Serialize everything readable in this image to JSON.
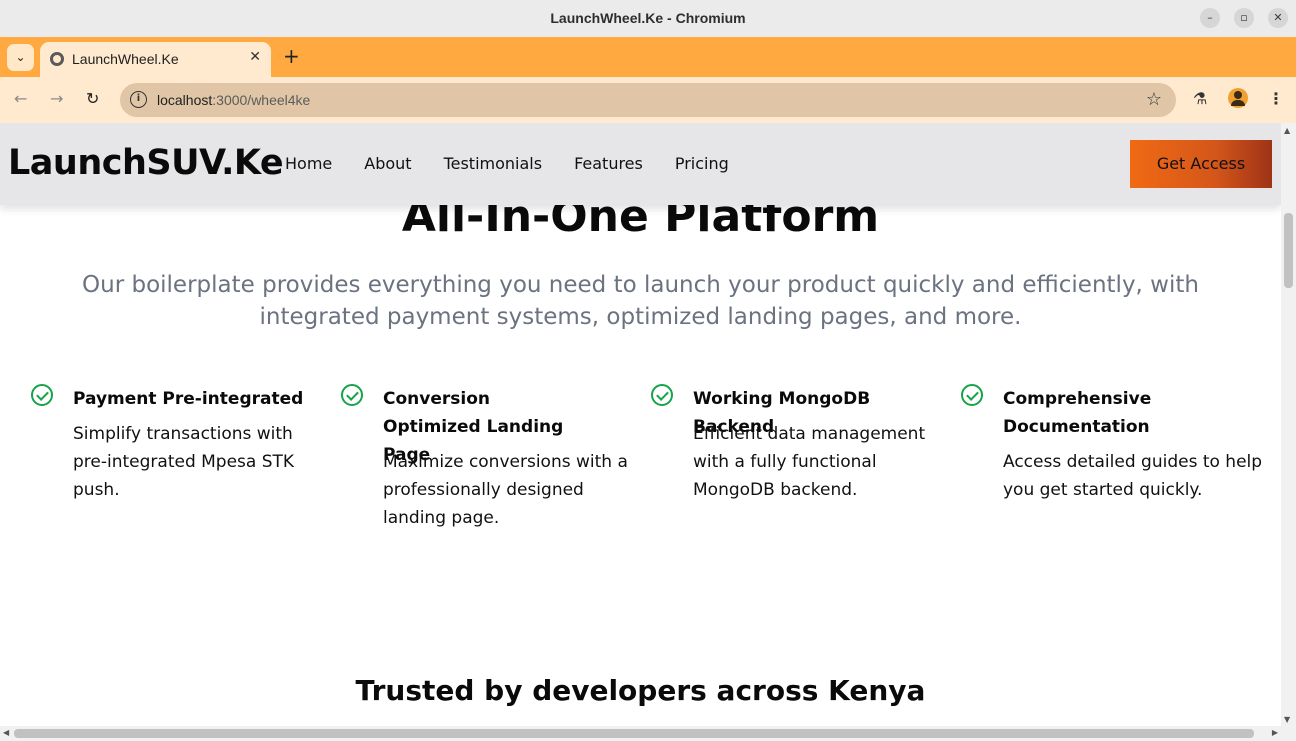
{
  "window": {
    "title": "LaunchWheel.Ke - Chromium"
  },
  "tab": {
    "title": "LaunchWheel.Ke"
  },
  "address": {
    "host": "localhost",
    "path": ":3000/wheel4ke"
  },
  "site": {
    "brand": "LaunchSUV.Ke",
    "nav": [
      "Home",
      "About",
      "Testimonials",
      "Features",
      "Pricing"
    ],
    "cta": "Get Access"
  },
  "hero": {
    "title": "All-In-One Platform",
    "subtitle": "Our boilerplate provides everything you need to launch your product quickly and efficiently, with integrated payment systems, optimized landing pages, and more."
  },
  "features": [
    {
      "title": "Payment Pre-integrated",
      "desc": "Simplify transactions with pre-integrated Mpesa STK push."
    },
    {
      "title": "Conversion Optimized Landing Page",
      "desc": "Maximize conversions with a professionally designed landing page."
    },
    {
      "title": "Working MongoDB Backend",
      "desc": "Efficient data management with a fully functional MongoDB backend."
    },
    {
      "title": "Comprehensive Documentation",
      "desc": "Access detailed guides to help you get started quickly."
    }
  ],
  "trusted": {
    "title": "Trusted by developers across Kenya"
  },
  "icons": {
    "tab_list": "chevron-down-icon",
    "favicon": "globe-icon",
    "close": "close-icon",
    "new_tab": "plus-icon",
    "back": "arrow-left-icon",
    "forward": "arrow-right-icon",
    "reload": "reload-icon",
    "site_info": "info-icon",
    "bookmark": "star-icon",
    "labs": "flask-icon",
    "profile": "avatar-icon",
    "menu": "kebab-menu-icon",
    "feature_check": "check-circle-icon"
  },
  "colors": {
    "tab_strip": "#ffa940",
    "toolbar": "#ffe9cf",
    "omnibox": "#e0c6a6",
    "site_nav": "#e6e6e8",
    "cta_gradient_start": "#f06a14",
    "cta_gradient_end": "#9e3316",
    "check_green": "#16a34a",
    "subtitle_gray": "#6b7280"
  }
}
